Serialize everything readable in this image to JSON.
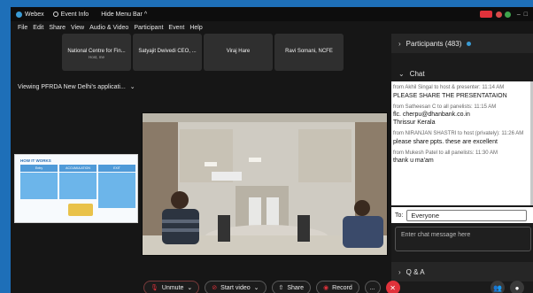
{
  "titlebar": {
    "app": "Webex",
    "event_info": "Event Info",
    "hide_menu": "Hide Menu Bar ^"
  },
  "menu": [
    "File",
    "Edit",
    "Share",
    "View",
    "Audio & Video",
    "Participant",
    "Event",
    "Help"
  ],
  "participants_strip": [
    {
      "name": "National Centre for Fin...",
      "sub": "Host, me"
    },
    {
      "name": "Satyajit Dwivedi CEO, ...",
      "sub": ""
    },
    {
      "name": "Viraj Hare",
      "sub": ""
    },
    {
      "name": "Ravi Somani, NCFE",
      "sub": ""
    }
  ],
  "viewing": "Viewing PFRDA New Delhi's applicati...",
  "slide": {
    "title": "HOW IT WORKS",
    "cols": [
      "Entry",
      "ACCUMULATION",
      "EXIT"
    ]
  },
  "panel": {
    "participants": "Participants (483)",
    "chat": "Chat",
    "qa": "Q & A",
    "to_label": "To:",
    "to_value": "Everyone",
    "input_placeholder": "Enter chat message here"
  },
  "messages": [
    {
      "meta": "from Akhil Singal to host & presenter:   11:14 AM",
      "text": "PLEASE SHARE THE PRESENTATAION"
    },
    {
      "meta": "from Satheesan C to all panelists:   11:15 AM",
      "text": "flc. cherpu@dhanbank.co.in\nThrissur    Kerala"
    },
    {
      "meta": "from NIRANJAN SHASTRI to host (privately):   11:26 AM",
      "text": "please share ppts. these are excellent"
    },
    {
      "meta": "from Mukesh Patel to all panelists:   11:30 AM",
      "text": "thank u ma'am"
    }
  ],
  "controls": {
    "unmute": "Unmute",
    "start_video": "Start video",
    "share": "Share",
    "record": "Record",
    "more": "..."
  },
  "colors": {
    "accent_red": "#e0323b",
    "panel_bg": "#1b1b1b",
    "frame_blue": "#1e6fb8"
  }
}
